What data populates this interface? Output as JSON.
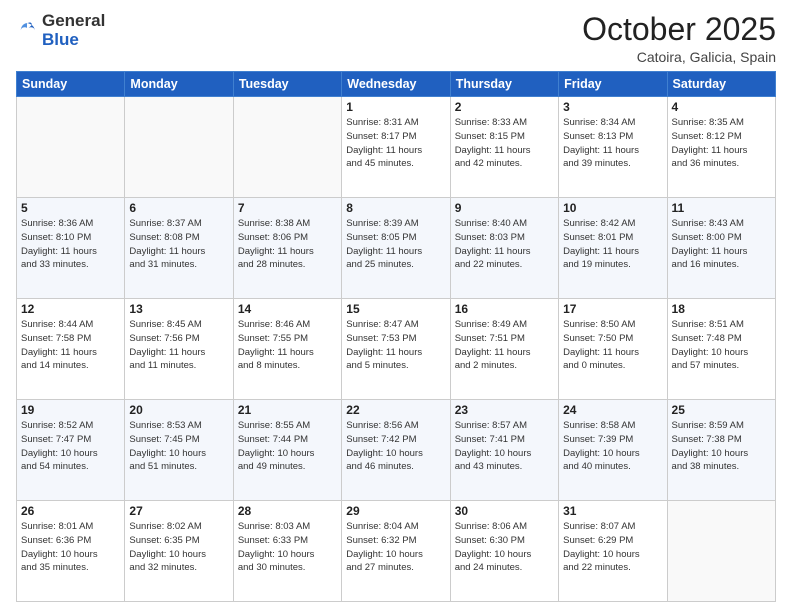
{
  "logo": {
    "general": "General",
    "blue": "Blue"
  },
  "header": {
    "month": "October 2025",
    "location": "Catoira, Galicia, Spain"
  },
  "weekdays": [
    "Sunday",
    "Monday",
    "Tuesday",
    "Wednesday",
    "Thursday",
    "Friday",
    "Saturday"
  ],
  "weeks": [
    [
      {
        "day": "",
        "info": ""
      },
      {
        "day": "",
        "info": ""
      },
      {
        "day": "",
        "info": ""
      },
      {
        "day": "1",
        "info": "Sunrise: 8:31 AM\nSunset: 8:17 PM\nDaylight: 11 hours\nand 45 minutes."
      },
      {
        "day": "2",
        "info": "Sunrise: 8:33 AM\nSunset: 8:15 PM\nDaylight: 11 hours\nand 42 minutes."
      },
      {
        "day": "3",
        "info": "Sunrise: 8:34 AM\nSunset: 8:13 PM\nDaylight: 11 hours\nand 39 minutes."
      },
      {
        "day": "4",
        "info": "Sunrise: 8:35 AM\nSunset: 8:12 PM\nDaylight: 11 hours\nand 36 minutes."
      }
    ],
    [
      {
        "day": "5",
        "info": "Sunrise: 8:36 AM\nSunset: 8:10 PM\nDaylight: 11 hours\nand 33 minutes."
      },
      {
        "day": "6",
        "info": "Sunrise: 8:37 AM\nSunset: 8:08 PM\nDaylight: 11 hours\nand 31 minutes."
      },
      {
        "day": "7",
        "info": "Sunrise: 8:38 AM\nSunset: 8:06 PM\nDaylight: 11 hours\nand 28 minutes."
      },
      {
        "day": "8",
        "info": "Sunrise: 8:39 AM\nSunset: 8:05 PM\nDaylight: 11 hours\nand 25 minutes."
      },
      {
        "day": "9",
        "info": "Sunrise: 8:40 AM\nSunset: 8:03 PM\nDaylight: 11 hours\nand 22 minutes."
      },
      {
        "day": "10",
        "info": "Sunrise: 8:42 AM\nSunset: 8:01 PM\nDaylight: 11 hours\nand 19 minutes."
      },
      {
        "day": "11",
        "info": "Sunrise: 8:43 AM\nSunset: 8:00 PM\nDaylight: 11 hours\nand 16 minutes."
      }
    ],
    [
      {
        "day": "12",
        "info": "Sunrise: 8:44 AM\nSunset: 7:58 PM\nDaylight: 11 hours\nand 14 minutes."
      },
      {
        "day": "13",
        "info": "Sunrise: 8:45 AM\nSunset: 7:56 PM\nDaylight: 11 hours\nand 11 minutes."
      },
      {
        "day": "14",
        "info": "Sunrise: 8:46 AM\nSunset: 7:55 PM\nDaylight: 11 hours\nand 8 minutes."
      },
      {
        "day": "15",
        "info": "Sunrise: 8:47 AM\nSunset: 7:53 PM\nDaylight: 11 hours\nand 5 minutes."
      },
      {
        "day": "16",
        "info": "Sunrise: 8:49 AM\nSunset: 7:51 PM\nDaylight: 11 hours\nand 2 minutes."
      },
      {
        "day": "17",
        "info": "Sunrise: 8:50 AM\nSunset: 7:50 PM\nDaylight: 11 hours\nand 0 minutes."
      },
      {
        "day": "18",
        "info": "Sunrise: 8:51 AM\nSunset: 7:48 PM\nDaylight: 10 hours\nand 57 minutes."
      }
    ],
    [
      {
        "day": "19",
        "info": "Sunrise: 8:52 AM\nSunset: 7:47 PM\nDaylight: 10 hours\nand 54 minutes."
      },
      {
        "day": "20",
        "info": "Sunrise: 8:53 AM\nSunset: 7:45 PM\nDaylight: 10 hours\nand 51 minutes."
      },
      {
        "day": "21",
        "info": "Sunrise: 8:55 AM\nSunset: 7:44 PM\nDaylight: 10 hours\nand 49 minutes."
      },
      {
        "day": "22",
        "info": "Sunrise: 8:56 AM\nSunset: 7:42 PM\nDaylight: 10 hours\nand 46 minutes."
      },
      {
        "day": "23",
        "info": "Sunrise: 8:57 AM\nSunset: 7:41 PM\nDaylight: 10 hours\nand 43 minutes."
      },
      {
        "day": "24",
        "info": "Sunrise: 8:58 AM\nSunset: 7:39 PM\nDaylight: 10 hours\nand 40 minutes."
      },
      {
        "day": "25",
        "info": "Sunrise: 8:59 AM\nSunset: 7:38 PM\nDaylight: 10 hours\nand 38 minutes."
      }
    ],
    [
      {
        "day": "26",
        "info": "Sunrise: 8:01 AM\nSunset: 6:36 PM\nDaylight: 10 hours\nand 35 minutes."
      },
      {
        "day": "27",
        "info": "Sunrise: 8:02 AM\nSunset: 6:35 PM\nDaylight: 10 hours\nand 32 minutes."
      },
      {
        "day": "28",
        "info": "Sunrise: 8:03 AM\nSunset: 6:33 PM\nDaylight: 10 hours\nand 30 minutes."
      },
      {
        "day": "29",
        "info": "Sunrise: 8:04 AM\nSunset: 6:32 PM\nDaylight: 10 hours\nand 27 minutes."
      },
      {
        "day": "30",
        "info": "Sunrise: 8:06 AM\nSunset: 6:30 PM\nDaylight: 10 hours\nand 24 minutes."
      },
      {
        "day": "31",
        "info": "Sunrise: 8:07 AM\nSunset: 6:29 PM\nDaylight: 10 hours\nand 22 minutes."
      },
      {
        "day": "",
        "info": ""
      }
    ]
  ]
}
